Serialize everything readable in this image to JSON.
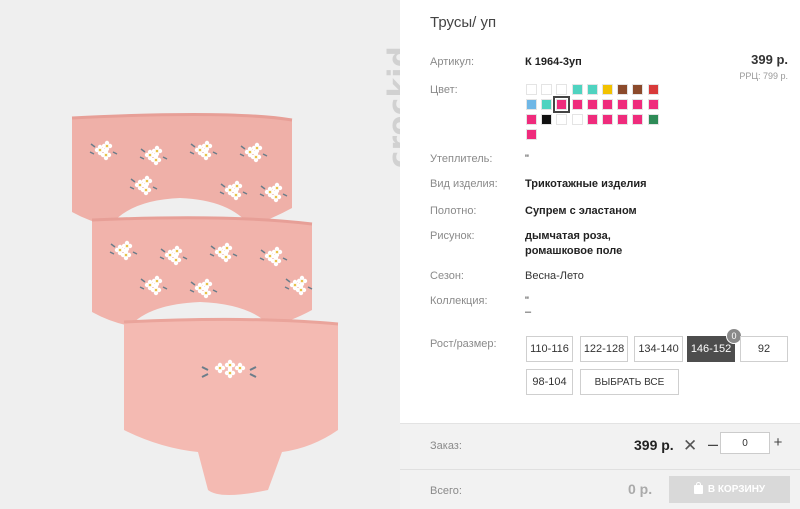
{
  "brand": "crockid",
  "product": {
    "title": "Трусы/ уп",
    "article_label": "Артикул:",
    "article_value": "К 1964-3уп",
    "price": "399 р.",
    "rrp": "РРЦ: 799 р.",
    "color_label": "Цвет:",
    "insulation_label": "Утеплитель:",
    "insulation_value": "\"",
    "type_label": "Вид изделия:",
    "type_value": "Трикотажные изделия",
    "fabric_label": "Полотно:",
    "fabric_value": "Супрем с эластаном",
    "pattern_label": "Рисунок:",
    "pattern_line1": "дымчатая роза,",
    "pattern_line2": "ромашковое поле",
    "season_label": "Сезон:",
    "season_value": "Весна-Лето",
    "collection_label": "Коллекция:",
    "collection_line1": "\"",
    "collection_line2": "–",
    "size_label": "Рост/размер:"
  },
  "colors": [
    "#ffffff",
    "#ffffff",
    "#ffffff",
    "#4fd3c0",
    "#4fd3c0",
    "#f2c200",
    "#8b4a2b",
    "#8b4a2b",
    "#d83a3a",
    "#6fb7e6",
    "#4fd3c0",
    "#ef2b7c",
    "#ef2b7c",
    "#ef2b7c",
    "#ef2b7c",
    "#ef2b7c",
    "#ef2b7c",
    "#ef2b7c",
    "#ef2b7c",
    "#111111",
    "#ffffff",
    "#ffffff",
    "#ef2b7c",
    "#ef2b7c",
    "#ef2b7c",
    "#ef2b7c",
    "#2e8b57",
    "#ef2b7c"
  ],
  "selected_color_index": 11,
  "sizes": [
    {
      "label": "110-116",
      "active": false
    },
    {
      "label": "122-128",
      "active": false
    },
    {
      "label": "134-140",
      "active": false
    },
    {
      "label": "146-152",
      "active": true,
      "badge": "0"
    },
    {
      "label": "92",
      "active": false
    },
    {
      "label": "98-104",
      "active": false
    },
    {
      "label": "ВЫБРАТЬ ВСЕ",
      "active": false
    }
  ],
  "order": {
    "order_label": "Заказ:",
    "order_price": "399 р.",
    "remove": "✕",
    "minus": "–",
    "qty": "0",
    "plus": "+",
    "total_label": "Всего:",
    "total_value": "0 р.",
    "cart_button": "В КОРЗИНУ"
  }
}
